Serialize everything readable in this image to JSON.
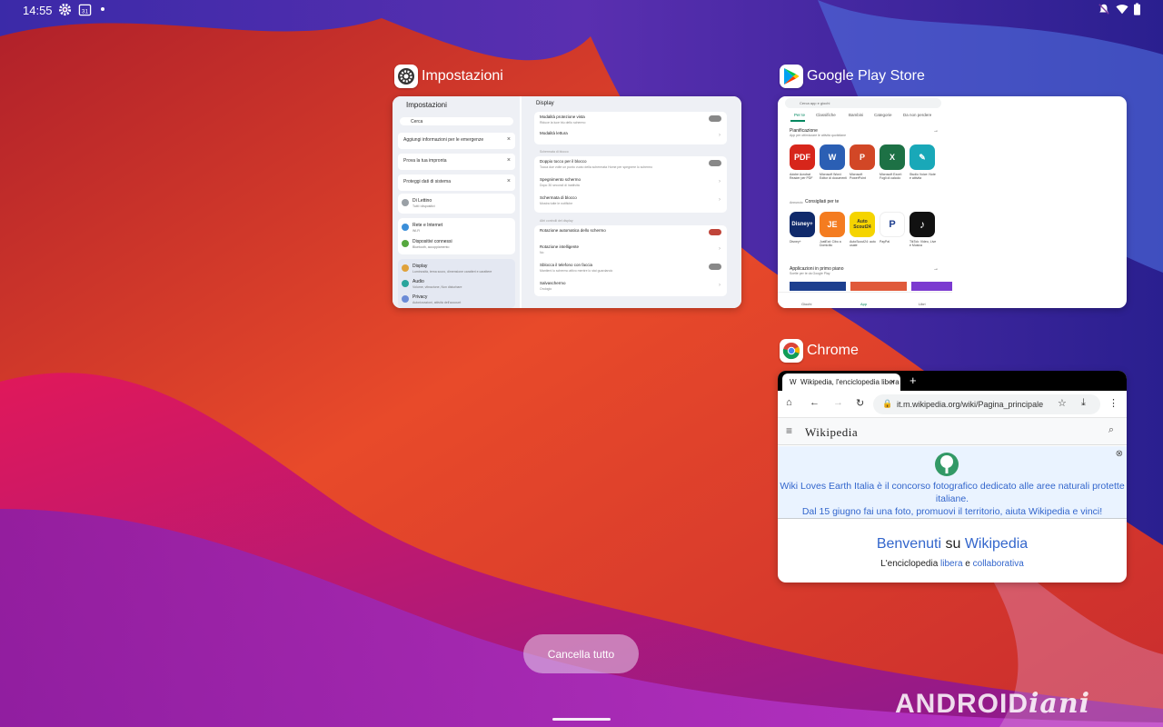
{
  "status_bar": {
    "time": "14:55",
    "calendar_day": "31"
  },
  "tasks": {
    "settings": {
      "app_name": "Impostazioni",
      "left_title": "Impostazioni",
      "search_placeholder": "Cerca",
      "suggestions": [
        "Aggiungi informazioni per le emergenze",
        "Prova la tua impronta",
        "Proteggi dati di sistema"
      ],
      "rows": [
        {
          "title": "Di Lettino",
          "sub": "Tutti i dispositivi",
          "color": "#9aa0a6"
        },
        {
          "title": "Rete e Internet",
          "sub": "Wi-Fi",
          "color": "#3b8fd9"
        },
        {
          "title": "Dispositivi connessi",
          "sub": "Bluetooth, accoppiamento",
          "color": "#56a83f"
        },
        {
          "title": "Display",
          "sub": "Luminosità, tema scuro, dimensione caratteri e carattere",
          "color": "#e0a23b"
        },
        {
          "title": "Audio",
          "sub": "Volume, vibrazione, Non disturbare",
          "color": "#2aa59c"
        },
        {
          "title": "Privacy",
          "sub": "Autorizzazioni, attività dell'account",
          "color": "#6b8bd6"
        }
      ],
      "right_title": "Display",
      "display_rows_1": [
        {
          "title": "Modalità protezione vista",
          "sub": "Riduce la luce blu dello schermo"
        },
        {
          "title": "Modalità lettura",
          "sub": ""
        }
      ],
      "section_2": "Schermata di blocco",
      "display_rows_2": [
        {
          "title": "Doppio tocco per il blocco",
          "sub": "Tocca due volte un punto vuoto della schermata Home per spegnere lo schermo"
        },
        {
          "title": "Spegnimento schermo",
          "sub": "Dopo 30 secondi di inattività"
        },
        {
          "title": "Schermata di blocco",
          "sub": "Mostra tutte le notifiche"
        }
      ],
      "section_3": "Altri controlli del display",
      "display_rows_3": [
        {
          "title": "Rotazione automatica dello schermo",
          "sub": ""
        },
        {
          "title": "Rotazione intelligente",
          "sub": "No"
        },
        {
          "title": "Sblocca il telefono con faccia",
          "sub": "Mantieni lo schermo attivo mentre lo stai guardando"
        },
        {
          "title": "Salvaschermo",
          "sub": "Orologio"
        }
      ]
    },
    "play": {
      "app_name": "Google Play Store",
      "search_placeholder": "Cerca app e giochi",
      "tabs": [
        "Per te",
        "Classifiche",
        "Bambini",
        "Categorie",
        "Da non perdere"
      ],
      "section_1": "Pianificazione",
      "section_1_sub": "App per ottimizzare le attività quotidiane",
      "apps_1": [
        {
          "name": "Adobe Acrobat Reader per PDF",
          "label": "PDF",
          "color": "#d7261b"
        },
        {
          "name": "Microsoft Word: Editor di documenti",
          "label": "W",
          "color": "#2b5fb4"
        },
        {
          "name": "Microsoft PowerPoint",
          "label": "P",
          "color": "#d24726"
        },
        {
          "name": "Microsoft Excel: Fogli di calcolo",
          "label": "X",
          "color": "#1d7145"
        },
        {
          "name": "Studio Voice: Note e attività",
          "label": "✎",
          "color": "#19a8b8"
        }
      ],
      "section_2_prefix": "Annuncio",
      "section_2": "Consigliati per te",
      "apps_2": [
        {
          "name": "Disney+",
          "label": "Disney+",
          "color": "#102a6b"
        },
        {
          "name": "JustEat: Cibo a Domicilio",
          "label": "JE",
          "color": "#f47c20"
        },
        {
          "name": "AutoScout24: auto usate",
          "label": "Auto Scout24",
          "color": "#f5d400"
        },
        {
          "name": "PayPal",
          "label": "P",
          "color": "#ffffff"
        },
        {
          "name": "TikTok: Video, Live e Musica",
          "label": "♪",
          "color": "#111111"
        }
      ],
      "section_3": "Applicazioni in primo piano",
      "section_3_sub": "Scelte per te da Google Play",
      "nav": [
        "Giochi",
        "App",
        "Libri"
      ]
    },
    "chrome": {
      "app_name": "Chrome",
      "tab_title": "Wikipedia, l'enciclopedia libera",
      "url": "it.m.wikipedia.org/wiki/Pagina_principale",
      "site_logo": "Wikipedia",
      "banner_line1": "Wiki Loves Earth Italia è il concorso fotografico dedicato alle aree naturali protette",
      "banner_line2": "italiane.",
      "banner_line3": "Dal 15 giugno fai una foto, promuovi il territorio, aiuta Wikipedia e vinci!",
      "welcome_a": "Benvenuti",
      "welcome_b": "su",
      "welcome_c": "Wikipedia",
      "tagline_a": "L'enciclopedia",
      "tagline_b": "libera",
      "tagline_c": "e",
      "tagline_d": "collaborativa"
    }
  },
  "actions": {
    "clear_all": "Cancella tutto"
  },
  "watermark": {
    "part1": "ANDROID",
    "part2": "iani"
  }
}
